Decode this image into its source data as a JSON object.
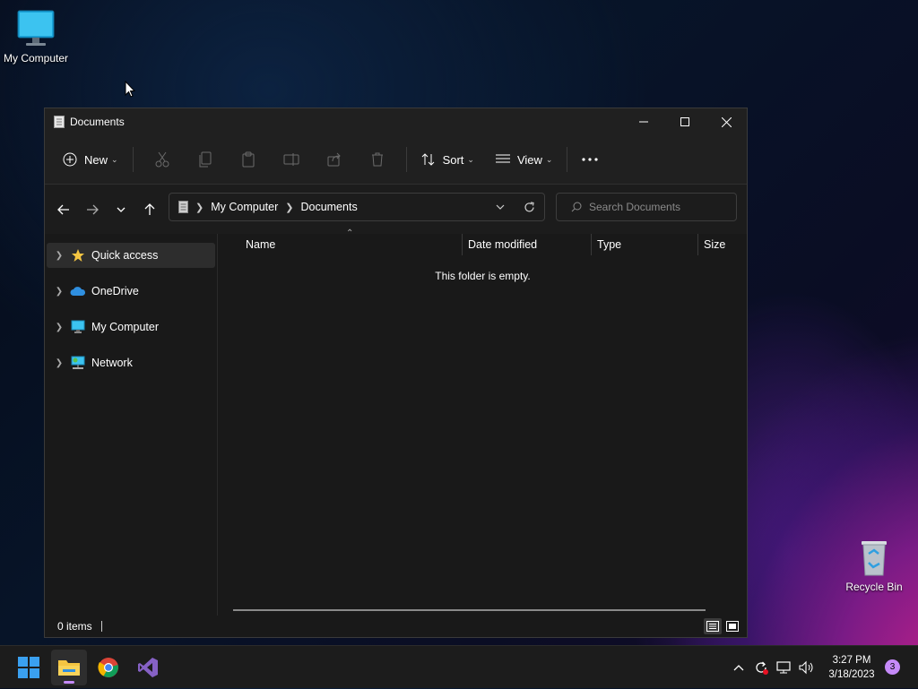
{
  "desktop": {
    "icons": [
      {
        "label": "My Computer"
      },
      {
        "label": "Recycle Bin"
      }
    ]
  },
  "window": {
    "title": "Documents",
    "toolbar": {
      "new_label": "New",
      "sort_label": "Sort",
      "view_label": "View"
    },
    "address": {
      "crumbs": [
        "My Computer",
        "Documents"
      ]
    },
    "search": {
      "placeholder": "Search Documents"
    },
    "sidebar": {
      "items": [
        {
          "label": "Quick access",
          "icon": "star-icon"
        },
        {
          "label": "OneDrive",
          "icon": "cloud-icon"
        },
        {
          "label": "My Computer",
          "icon": "monitor-icon"
        },
        {
          "label": "Network",
          "icon": "network-icon"
        }
      ]
    },
    "columns": [
      "Name",
      "Date modified",
      "Type",
      "Size"
    ],
    "empty_message": "This folder is empty.",
    "status": {
      "item_count": "0 items"
    }
  },
  "taskbar": {
    "apps": [
      "start",
      "file-explorer",
      "chrome",
      "visual-studio"
    ],
    "clock": {
      "time": "3:27 PM",
      "date": "3/18/2023"
    },
    "notification_count": "3"
  },
  "colors": {
    "accent": "#c58af9",
    "folder_yellow": "#f4c542",
    "window_bg": "#191919"
  }
}
